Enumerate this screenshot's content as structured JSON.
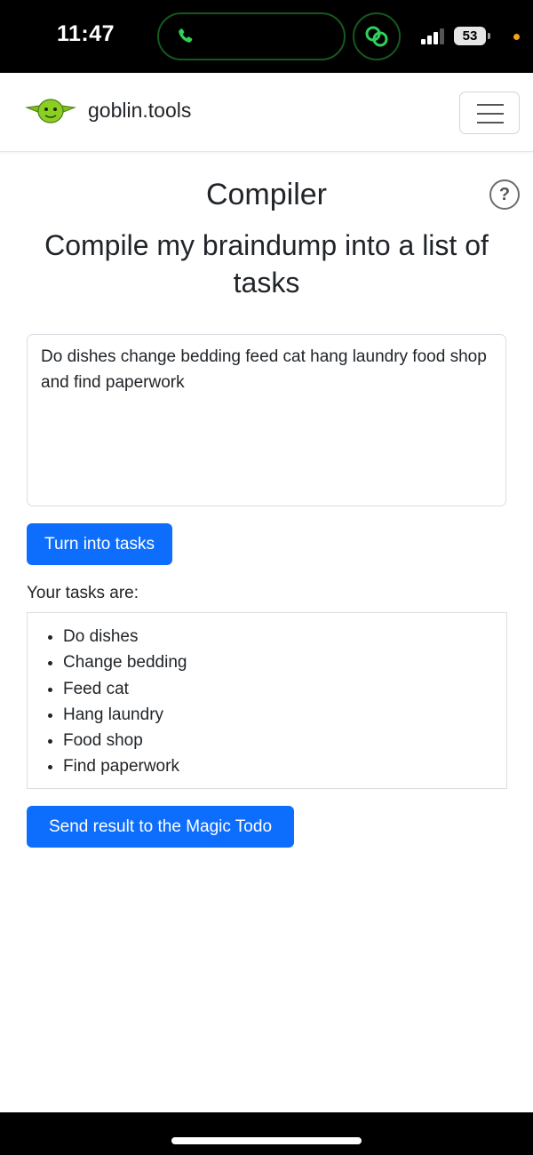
{
  "status_bar": {
    "time": "11:47",
    "battery": "53",
    "icons": [
      "phone-icon",
      "chain-link-icon",
      "signal-icon",
      "battery-icon"
    ],
    "colors": {
      "island_border": "#145a1e",
      "phone_green": "#30d158",
      "dot_orange": "#f7a21b"
    }
  },
  "navbar": {
    "brand": "goblin.tools",
    "logo_icon": "goblin-head-icon",
    "menu_icon": "hamburger-icon"
  },
  "main": {
    "title": "Compiler",
    "subtitle": "Compile my braindump into a list of tasks",
    "help_icon": "?",
    "braindump_value": "Do dishes change bedding feed cat hang laundry food shop and find paperwork",
    "turn_button": "Turn into tasks",
    "tasks_label": "Your tasks are:",
    "tasks": [
      "Do dishes",
      "Change bedding",
      "Feed cat",
      "Hang laundry",
      "Food shop",
      "Find paperwork"
    ],
    "send_button": "Send result to the Magic Todo"
  },
  "colors": {
    "primary": "#0d6efd",
    "text": "#212529",
    "border": "#d9dde1"
  }
}
